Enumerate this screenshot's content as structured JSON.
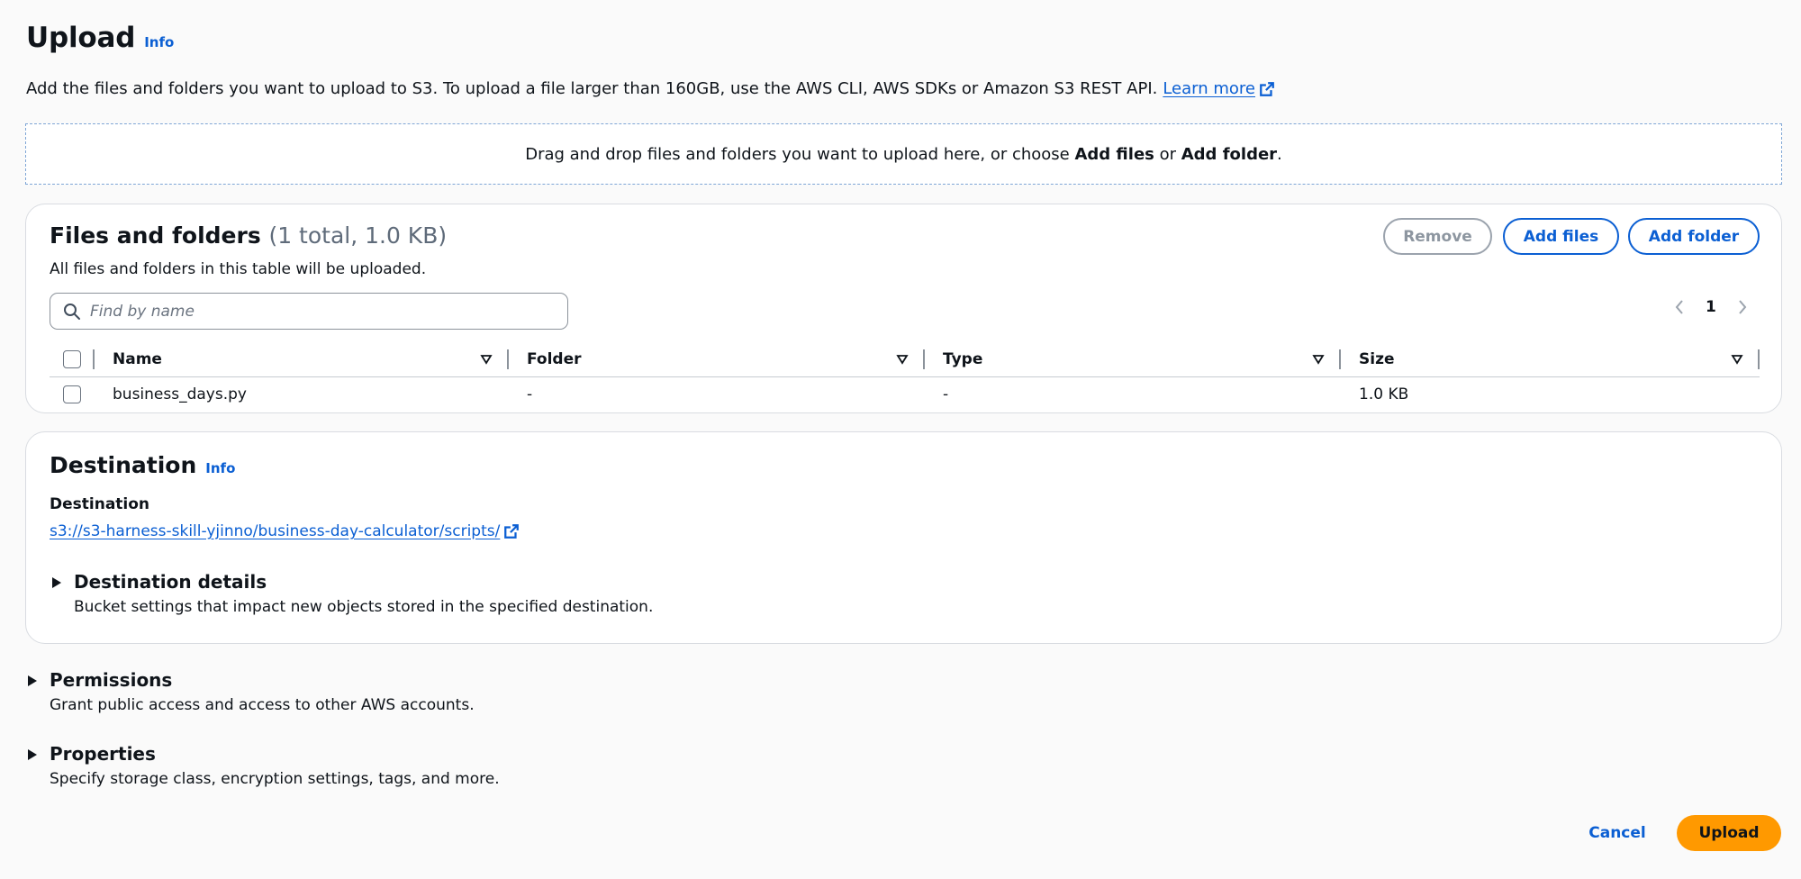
{
  "header": {
    "title": "Upload",
    "info_label": "Info",
    "intro_text": "Add the files and folders you want to upload to S3. To upload a file larger than 160GB, use the AWS CLI, AWS SDKs or Amazon S3 REST API.",
    "learn_more_label": "Learn more"
  },
  "dropzone": {
    "text_before": "Drag and drop files and folders you want to upload here, or choose ",
    "add_files": "Add files",
    "or": " or ",
    "add_folder": "Add folder",
    "text_after": "."
  },
  "files": {
    "title": "Files and folders",
    "count": "(1 total, 1.0 KB)",
    "description": "All files and folders in this table will be uploaded.",
    "buttons": {
      "remove": "Remove",
      "add_files": "Add files",
      "add_folder": "Add folder"
    },
    "search": {
      "placeholder": "Find by name",
      "value": ""
    },
    "pagination": {
      "current_page": "1"
    },
    "columns": {
      "name": "Name",
      "folder": "Folder",
      "type": "Type",
      "size": "Size"
    },
    "rows": [
      {
        "name": "business_days.py",
        "folder": "-",
        "type": "-",
        "size": "1.0 KB"
      }
    ]
  },
  "destination": {
    "title": "Destination",
    "info_label": "Info",
    "label": "Destination",
    "link": "s3://s3-harness-skill-yjinno/business-day-calculator/scripts/",
    "details_title": "Destination details",
    "details_desc": "Bucket settings that impact new objects stored in the specified destination."
  },
  "permissions": {
    "title": "Permissions",
    "desc": "Grant public access and access to other AWS accounts."
  },
  "properties": {
    "title": "Properties",
    "desc": "Specify storage class, encryption settings, tags, and more."
  },
  "footer": {
    "cancel": "Cancel",
    "upload": "Upload"
  },
  "icons": {
    "external_link": "external-link-icon",
    "search": "search-icon",
    "sort": "sort-down-icon",
    "caret": "caret-right-icon",
    "chevron_left": "chevron-left-icon",
    "chevron_right": "chevron-right-icon"
  },
  "colors": {
    "link": "#0b5fd3",
    "primary_button": "#ff9900"
  }
}
